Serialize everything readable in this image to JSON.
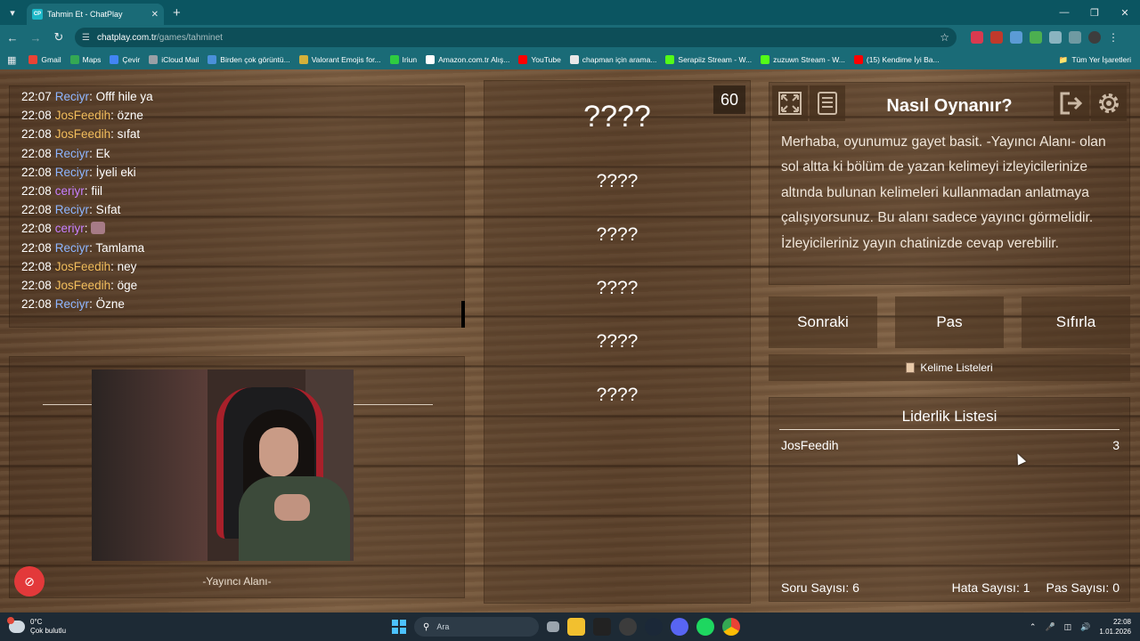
{
  "browser": {
    "tab_title": "Tahmin Et - ChatPlay",
    "tab_favicon": "CP",
    "url_host": "chatplay.com.tr",
    "url_path": "/games/tahminet",
    "bookmarks": [
      {
        "label": "Gmail",
        "color": "#ea4335"
      },
      {
        "label": "Maps",
        "color": "#34a853"
      },
      {
        "label": "Çevir",
        "color": "#4285f4"
      },
      {
        "label": "iCloud Mail",
        "color": "#9aa0a6"
      },
      {
        "label": "Birden çok görüntü...",
        "color": "#4a90d9"
      },
      {
        "label": "Valorant Emojis for...",
        "color": "#d4b13a"
      },
      {
        "label": "Iriun",
        "color": "#2ecc40"
      },
      {
        "label": "Amazon.com.tr Alış...",
        "color": "#ffffff"
      },
      {
        "label": "YouTube",
        "color": "#ff0000"
      },
      {
        "label": "chapman için arama...",
        "color": "#e8e8e8"
      },
      {
        "label": "Serapiiz Stream - W...",
        "color": "#53fc18"
      },
      {
        "label": "zuzuwn Stream - W...",
        "color": "#53fc18"
      },
      {
        "label": "(15) Kendime İyi Ba...",
        "color": "#ff0000"
      }
    ],
    "bookmarks_all": "Tüm Yer İşaretleri"
  },
  "chat": [
    {
      "time": "22:07",
      "user": "Reciyr",
      "color": "recyr",
      "msg": "Offf hile ya"
    },
    {
      "time": "22:08",
      "user": "JosFeedih",
      "color": "jos",
      "msg": "özne"
    },
    {
      "time": "22:08",
      "user": "JosFeedih",
      "color": "jos",
      "msg": "sıfat"
    },
    {
      "time": "22:08",
      "user": "Reciyr",
      "color": "recyr",
      "msg": "Ek"
    },
    {
      "time": "22:08",
      "user": "Reciyr",
      "color": "recyr",
      "msg": "İyeli eki"
    },
    {
      "time": "22:08",
      "user": "ceriyr",
      "color": "ceriyr",
      "msg": "fiil"
    },
    {
      "time": "22:08",
      "user": "Reciyr",
      "color": "recyr",
      "msg": "Sıfat"
    },
    {
      "time": "22:08",
      "user": "ceriyr",
      "color": "ceriyr",
      "msg": "",
      "emote": true
    },
    {
      "time": "22:08",
      "user": "Reciyr",
      "color": "recyr",
      "msg": "Tamlama"
    },
    {
      "time": "22:08",
      "user": "JosFeedih",
      "color": "jos",
      "msg": "ney"
    },
    {
      "time": "22:08",
      "user": "JosFeedih",
      "color": "jos",
      "msg": "öge"
    },
    {
      "time": "22:08",
      "user": "Reciyr",
      "color": "recyr",
      "msg": "Özne"
    }
  ],
  "streamer": {
    "label": "-Yayıncı Alanı-"
  },
  "game": {
    "timer": "60",
    "main_word": "????",
    "forbidden_words": [
      "????",
      "????",
      "????",
      "????",
      "????"
    ]
  },
  "howto": {
    "title": "Nasıl Oynanır?",
    "text": "Merhaba, oyunumuz gayet basit. -Yayıncı Alanı- olan sol altta ki bölüm de yazan kelimeyi izleyicilerinize altında bulunan kelimeleri kullanmadan anlatmaya çalışıyorsunuz. Bu alanı sadece yayıncı görmelidir. İzleyicileriniz yayın chatinizde cevap verebilir."
  },
  "controls": {
    "next": "Sonraki",
    "pass": "Pas",
    "reset": "Sıfırla",
    "word_lists": "Kelime Listeleri"
  },
  "leaderboard": {
    "title": "Liderlik Listesi",
    "rows": [
      {
        "name": "JosFeedih",
        "score": "3"
      }
    ],
    "question_count": "Soru Sayısı: 6",
    "error_count": "Hata Sayısı: 1",
    "pass_count": "Pas Sayısı: 0"
  },
  "taskbar": {
    "temp": "0°C",
    "weather": "Çok bulutlu",
    "search_placeholder": "Ara",
    "time": "22:08",
    "date": "1.01.2026"
  }
}
